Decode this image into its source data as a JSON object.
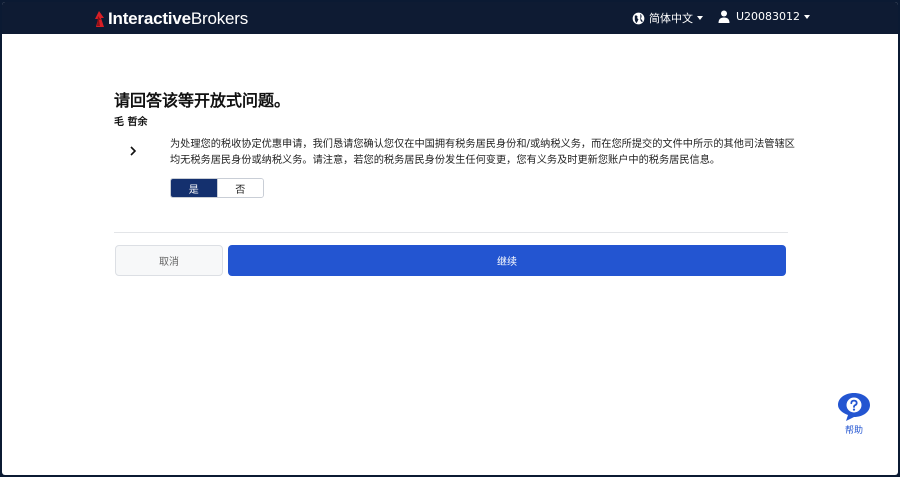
{
  "header": {
    "logo_bold": "Interactive",
    "logo_light": "Brokers",
    "language": "简体中文",
    "user_id": "U20083012"
  },
  "main": {
    "title": "请回答该等开放式问题。",
    "person_name": "毛 哲余",
    "question": "为处理您的税收协定优惠申请，我们恳请您确认您仅在中国拥有税务居民身份和/或纳税义务，而在您所提交的文件中所示的其他司法管辖区均无税务居民身份或纳税义务。请注意，若您的税务居民身份发生任何变更，您有义务及时更新您账户中的税务居民信息。",
    "options": {
      "yes": "是",
      "no": "否",
      "selected": "yes"
    }
  },
  "actions": {
    "cancel_label": "取消",
    "continue_label": "继续"
  },
  "help": {
    "label": "帮助"
  },
  "colors": {
    "topbar": "#0e1b33",
    "primary": "#2355d1",
    "toggle_active": "#14306e",
    "logo_red": "#d81f26"
  }
}
